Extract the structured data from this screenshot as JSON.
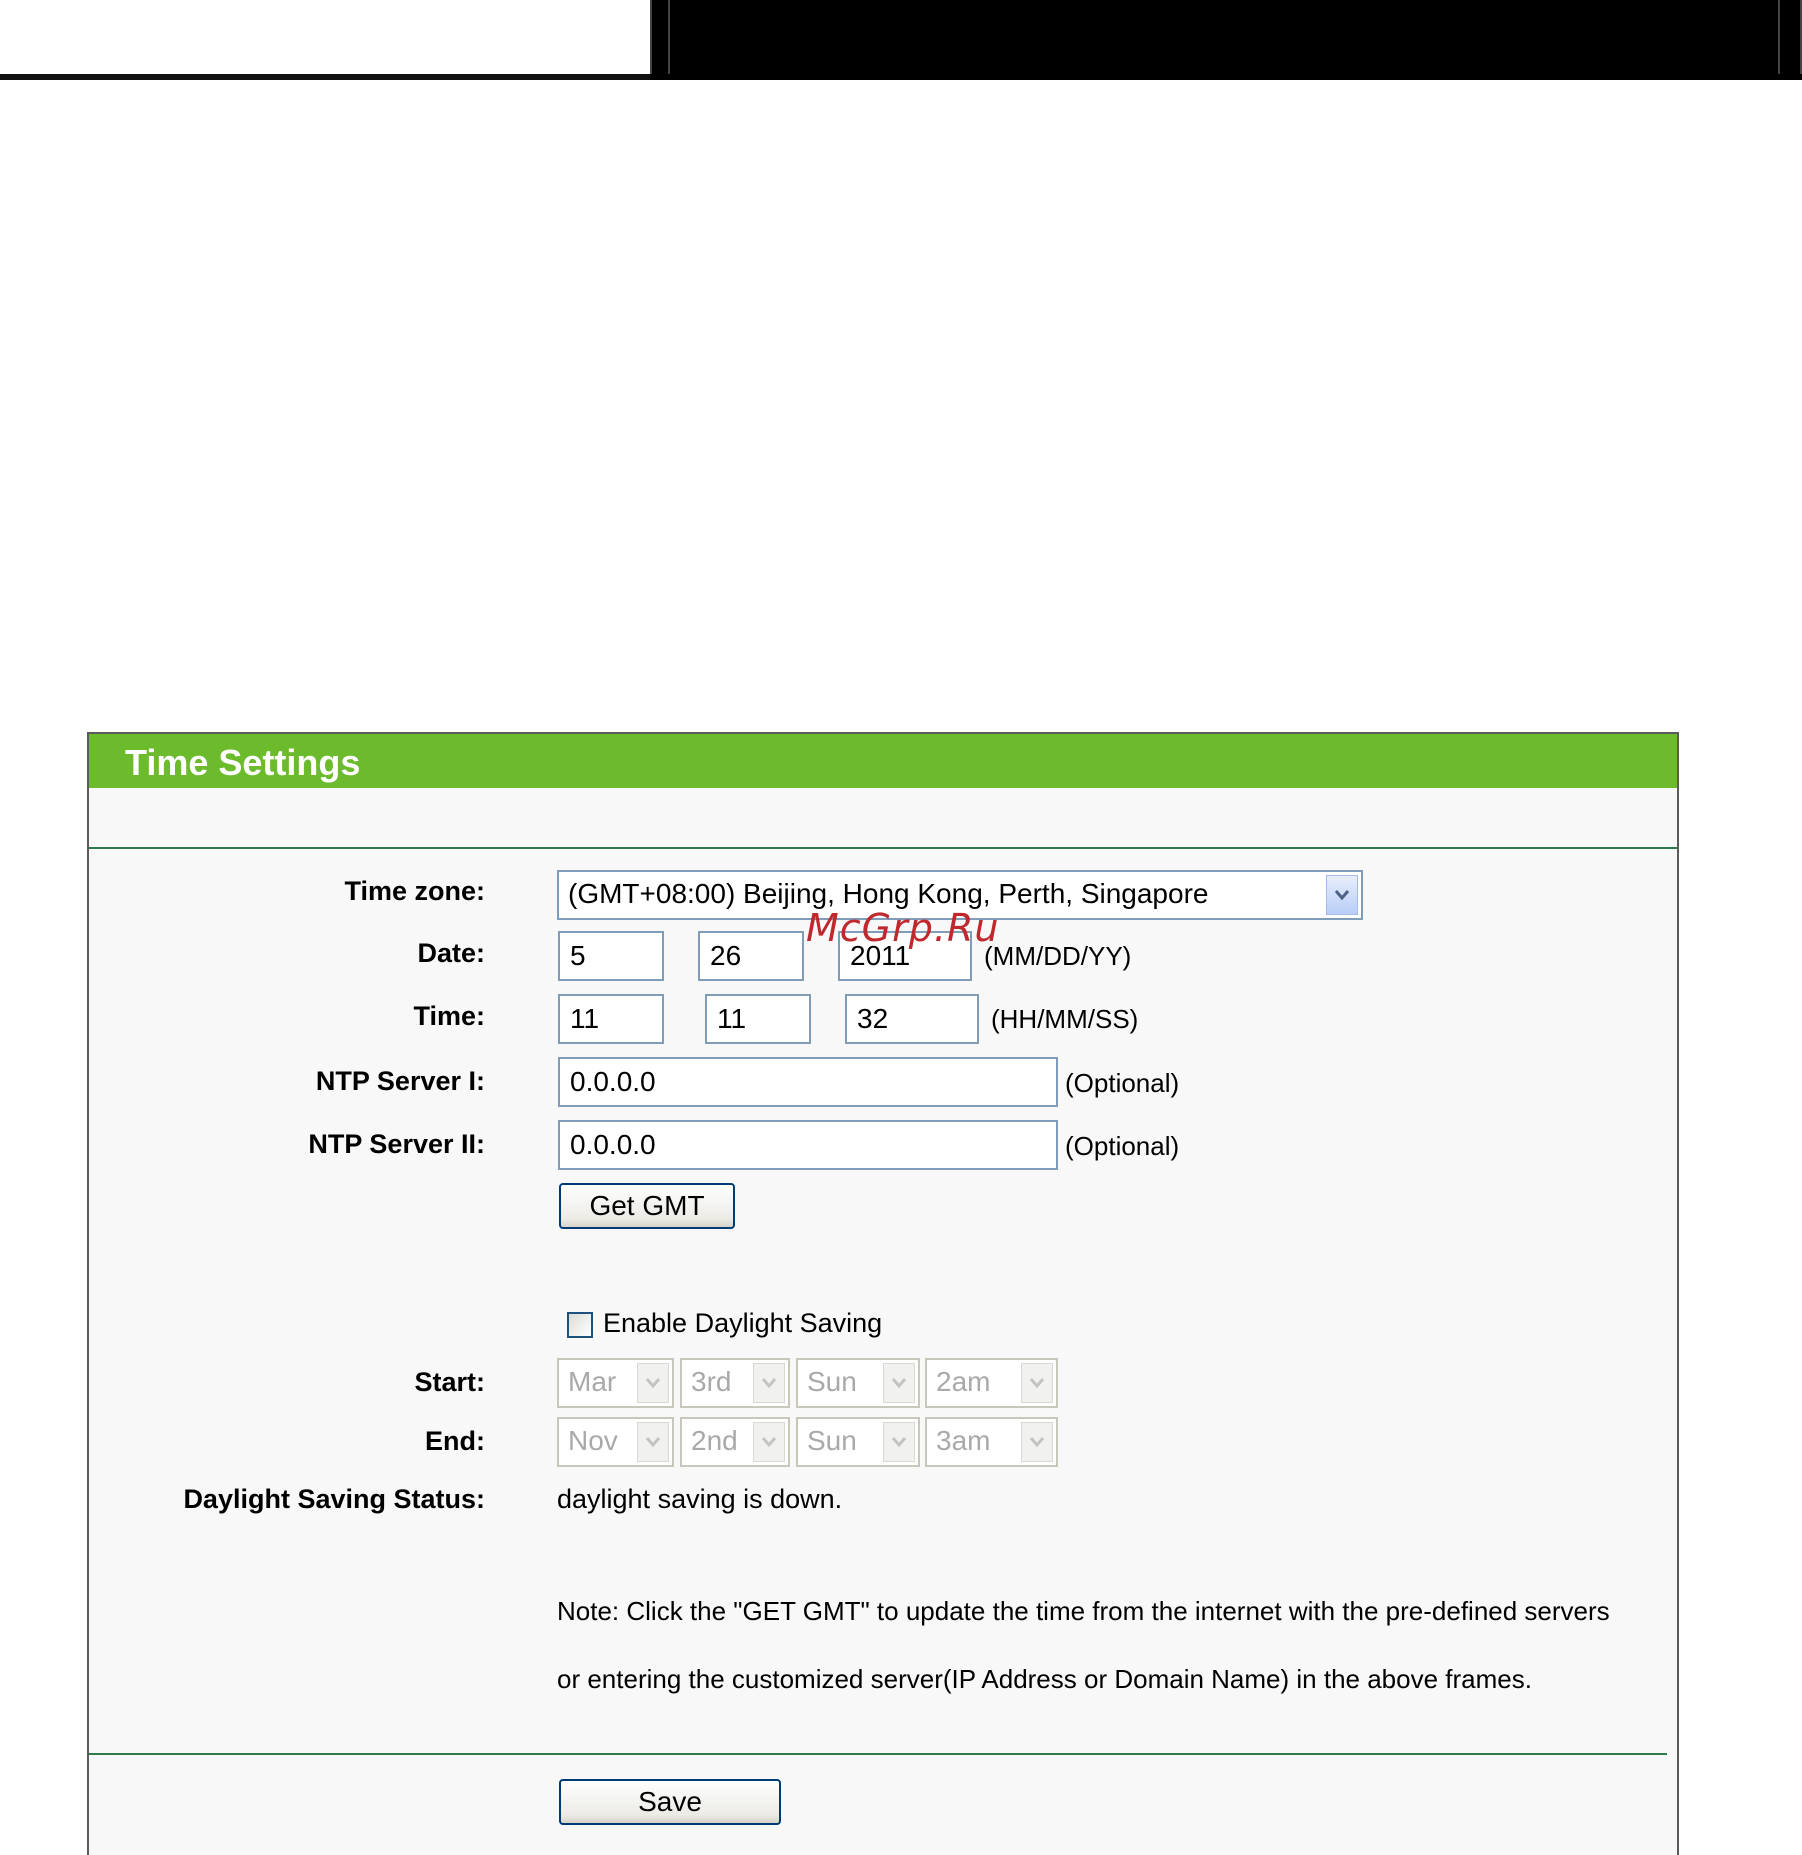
{
  "panel": {
    "title": "Time Settings",
    "header_color": "#6cbb2c"
  },
  "fields": {
    "time_zone": {
      "label": "Time zone:",
      "value": "(GMT+08:00) Beijing, Hong Kong, Perth, Singapore"
    },
    "date": {
      "label": "Date:",
      "month": "5",
      "day": "26",
      "year": "2011",
      "hint": "(MM/DD/YY)"
    },
    "time": {
      "label": "Time:",
      "hour": "11",
      "minute": "11",
      "second": "32",
      "hint": "(HH/MM/SS)"
    },
    "ntp1": {
      "label": "NTP Server I:",
      "value": "0.0.0.0",
      "hint": "(Optional)"
    },
    "ntp2": {
      "label": "NTP Server II:",
      "value": "0.0.0.0",
      "hint": "(Optional)"
    }
  },
  "get_gmt_button": "Get GMT",
  "daylight": {
    "checkbox_label": "Enable Daylight Saving",
    "checked": false,
    "start_label": "Start:",
    "start": {
      "month": "Mar",
      "week": "3rd",
      "day": "Sun",
      "hour": "2am"
    },
    "end_label": "End:",
    "end": {
      "month": "Nov",
      "week": "2nd",
      "day": "Sun",
      "hour": "3am"
    },
    "status_label": "Daylight Saving Status:",
    "status_value": "daylight saving is down."
  },
  "note": {
    "line1": "Note: Click the \"GET GMT\" to update the time from the internet with the pre-defined servers",
    "line2": "or entering the customized server(IP Address or Domain Name) in the above frames."
  },
  "save_button": "Save",
  "watermark": "McGrp.Ru"
}
